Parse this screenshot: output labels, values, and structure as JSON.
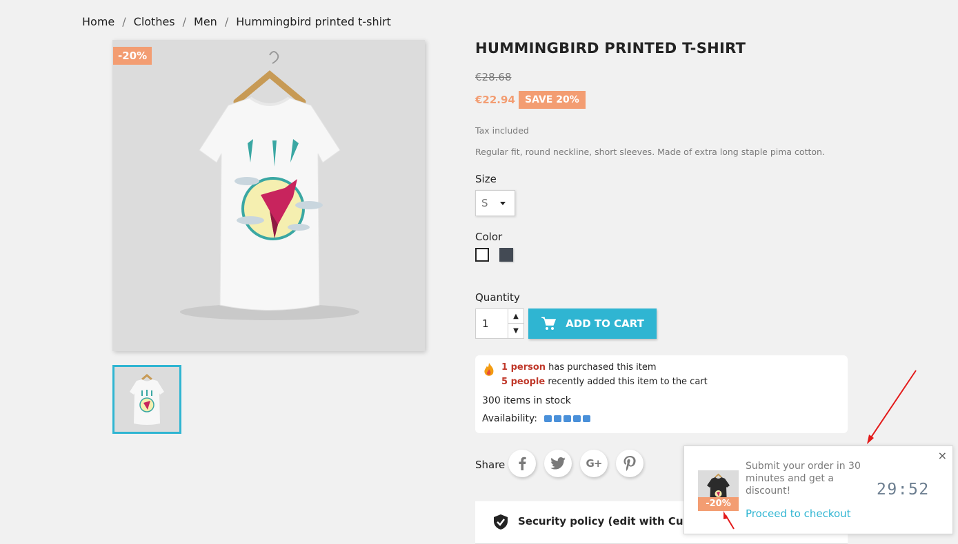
{
  "breadcrumb": [
    "Home",
    "Clothes",
    "Men",
    "Hummingbird printed t-shirt"
  ],
  "product": {
    "discount_badge": "-20%",
    "title": "HUMMINGBIRD PRINTED T-SHIRT",
    "old_price": "€28.68",
    "new_price": "€22.94",
    "save_label": "SAVE 20%",
    "tax": "Tax included",
    "description": "Regular fit, round neckline, short sleeves. Made of extra long staple pima cotton."
  },
  "size": {
    "label": "Size",
    "selected": "S"
  },
  "color": {
    "label": "Color",
    "options": [
      "#ffffff",
      "#434a54"
    ]
  },
  "quantity": {
    "label": "Quantity",
    "value": "1"
  },
  "add_to_cart": "ADD TO CART",
  "stock": {
    "purchased_count": "1 person",
    "purchased_text": " has purchased this item",
    "added_count": "5 people",
    "added_text": " recently added this item to the cart",
    "in_stock": "300 items in stock",
    "availability_label": "Availability:"
  },
  "share": {
    "label": "Share",
    "networks": [
      "facebook-icon",
      "twitter-icon",
      "google-plus-icon",
      "pinterest-icon"
    ]
  },
  "policy": {
    "text": "Security policy (edit with Customer reassurance module)"
  },
  "popup": {
    "badge": "-20%",
    "message": "Submit your order in 30 minutes and get a discount!",
    "link": "Proceed to checkout",
    "timer": "29:52",
    "close": "×"
  },
  "colors": {
    "accent": "#2fb5d2",
    "discount": "#f39d72",
    "highlight": "#c0392b"
  }
}
